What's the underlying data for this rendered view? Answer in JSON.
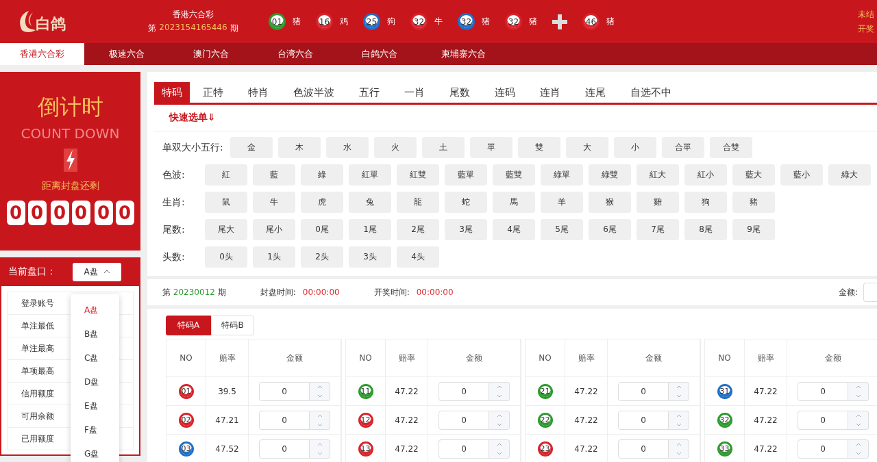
{
  "header": {
    "logo_text": "白鸽",
    "lottery_name": "香港六合彩",
    "period_prefix": "第",
    "period": "2023154165446",
    "period_suffix": "期",
    "results": [
      {
        "kind": "ball",
        "number": "01",
        "zodiac": "猪",
        "color": "#2e9a2e"
      },
      {
        "kind": "ball",
        "number": "16",
        "zodiac": "鸡",
        "color": "#d9232a"
      },
      {
        "kind": "ball",
        "number": "25",
        "zodiac": "狗",
        "color": "#1f6fc9"
      },
      {
        "kind": "ball",
        "number": "32",
        "zodiac": "牛",
        "color": "#d9232a"
      },
      {
        "kind": "ball",
        "number": "32",
        "zodiac": "猪",
        "color": "#1f6fc9"
      },
      {
        "kind": "ball",
        "number": "32",
        "zodiac": "猪",
        "color": "#d9232a"
      },
      {
        "kind": "plus"
      },
      {
        "kind": "ball",
        "number": "46",
        "zodiac": "猪",
        "color": "#d9232a"
      }
    ],
    "notes": [
      "未结",
      "开奖"
    ]
  },
  "nav": [
    {
      "label": "香港六合彩",
      "selected": true
    },
    {
      "label": "极速六合",
      "selected": false
    },
    {
      "label": "澳门六合",
      "selected": false
    },
    {
      "label": "台湾六合",
      "selected": false
    },
    {
      "label": "白鸽六合",
      "selected": false
    },
    {
      "label": "柬埔寨六合",
      "selected": false
    }
  ],
  "countdown": {
    "title": "倒计时",
    "subtitle": "COUNT DOWN",
    "caption": "距离封盘还剩",
    "digits": [
      "0",
      "0",
      "0",
      "0",
      "0",
      "0"
    ]
  },
  "handicap": {
    "label": "当前盘口：",
    "value": "A盘",
    "expanded": true,
    "options": [
      {
        "label": "A盘",
        "selected": true
      },
      {
        "label": "B盘",
        "selected": false
      },
      {
        "label": "C盘",
        "selected": false
      },
      {
        "label": "D盘",
        "selected": false
      },
      {
        "label": "E盘",
        "selected": false
      },
      {
        "label": "F盘",
        "selected": false
      },
      {
        "label": "G盘",
        "selected": false
      }
    ],
    "info_rows": [
      "登录账号",
      "单注最低",
      "单注最高",
      "单项最高",
      "信用额度",
      "可用余额",
      "已用额度"
    ]
  },
  "game_tabs": [
    {
      "label": "特码",
      "selected": true
    },
    {
      "label": "正特",
      "selected": false
    },
    {
      "label": "特肖",
      "selected": false
    },
    {
      "label": "色波半波",
      "selected": false
    },
    {
      "label": "五行",
      "selected": false
    },
    {
      "label": "一肖",
      "selected": false
    },
    {
      "label": "尾数",
      "selected": false
    },
    {
      "label": "连码",
      "selected": false
    },
    {
      "label": "连肖",
      "selected": false
    },
    {
      "label": "连尾",
      "selected": false
    },
    {
      "label": "自选不中",
      "selected": false
    }
  ],
  "quick_select": {
    "title": "快速选单⇓",
    "rows": [
      {
        "label": "单双大小五行:",
        "options": [
          "金",
          "木",
          "水",
          "火",
          "土",
          "單",
          "雙",
          "大",
          "小",
          "合單",
          "合雙"
        ]
      },
      {
        "label": "色波:",
        "options": [
          "紅",
          "藍",
          "綠",
          "紅單",
          "紅雙",
          "藍單",
          "藍雙",
          "綠單",
          "綠雙",
          "紅大",
          "紅小",
          "藍大",
          "藍小",
          "綠大"
        ]
      },
      {
        "label": "生肖:",
        "options": [
          "鼠",
          "牛",
          "虎",
          "兔",
          "龍",
          "蛇",
          "馬",
          "羊",
          "猴",
          "雞",
          "狗",
          "豬"
        ]
      },
      {
        "label": "尾数:",
        "options": [
          "尾大",
          "尾小",
          "0尾",
          "1尾",
          "2尾",
          "3尾",
          "4尾",
          "5尾",
          "6尾",
          "7尾",
          "8尾",
          "9尾"
        ]
      },
      {
        "label": "头数:",
        "options": [
          "0头",
          "1头",
          "2头",
          "3头",
          "4头"
        ]
      }
    ]
  },
  "period_bar": {
    "prefix": "第",
    "period": "20230012",
    "suffix": "期",
    "close_label": "封盘时间:",
    "close_time": "00:00:00",
    "draw_label": "开奖时间:",
    "draw_time": "00:00:00",
    "amount_label": "金额:"
  },
  "bet_tabs": [
    {
      "label": "特码A",
      "selected": true
    },
    {
      "label": "特码B",
      "selected": false
    }
  ],
  "table": {
    "groups": [
      {
        "columns": [
          "NO",
          "赔率",
          "金额"
        ],
        "rows": [
          {
            "number": "01",
            "color": "#d9232a",
            "odds": "39.5",
            "amount": "0"
          },
          {
            "number": "02",
            "color": "#d9232a",
            "odds": "47.21",
            "amount": "0"
          },
          {
            "number": "03",
            "color": "#1f6fc9",
            "odds": "47.52",
            "amount": "0"
          }
        ]
      },
      {
        "columns": [
          "NO",
          "赔率",
          "金额"
        ],
        "rows": [
          {
            "number": "11",
            "color": "#2e9a2e",
            "odds": "47.22",
            "amount": "0"
          },
          {
            "number": "12",
            "color": "#d9232a",
            "odds": "47.22",
            "amount": "0"
          },
          {
            "number": "13",
            "color": "#d9232a",
            "odds": "47.22",
            "amount": "0"
          }
        ]
      },
      {
        "columns": [
          "NO",
          "赔率",
          "金额"
        ],
        "rows": [
          {
            "number": "21",
            "color": "#2e9a2e",
            "odds": "47.22",
            "amount": "0"
          },
          {
            "number": "22",
            "color": "#2e9a2e",
            "odds": "47.22",
            "amount": "0"
          },
          {
            "number": "23",
            "color": "#d9232a",
            "odds": "47.22",
            "amount": "0"
          }
        ]
      },
      {
        "columns": [
          "NO",
          "赔率",
          "金额"
        ],
        "rows": [
          {
            "number": "31",
            "color": "#1f6fc9",
            "odds": "47.22",
            "amount": "0"
          },
          {
            "number": "32",
            "color": "#2e9a2e",
            "odds": "47.22",
            "amount": "0"
          },
          {
            "number": "33",
            "color": "#2e9a2e",
            "odds": "47.22",
            "amount": "0"
          }
        ]
      }
    ]
  }
}
